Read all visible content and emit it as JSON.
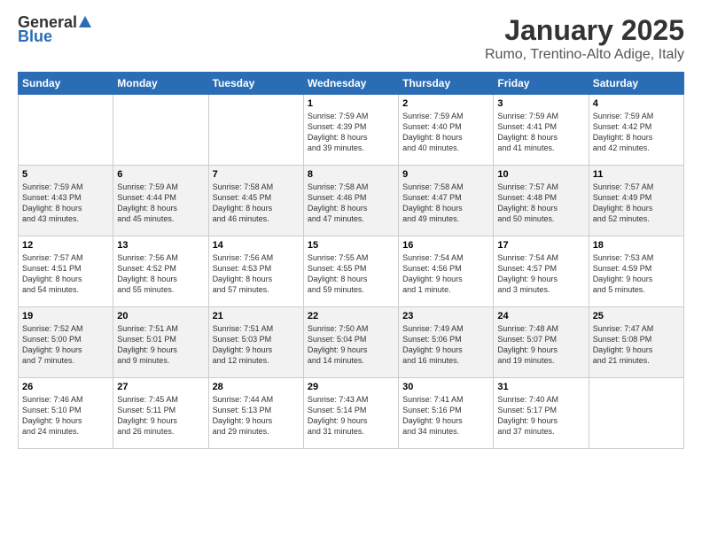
{
  "logo": {
    "general": "General",
    "blue": "Blue"
  },
  "header": {
    "title": "January 2025",
    "subtitle": "Rumo, Trentino-Alto Adige, Italy"
  },
  "columns": [
    "Sunday",
    "Monday",
    "Tuesday",
    "Wednesday",
    "Thursday",
    "Friday",
    "Saturday"
  ],
  "weeks": [
    [
      {
        "day": "",
        "info": ""
      },
      {
        "day": "",
        "info": ""
      },
      {
        "day": "",
        "info": ""
      },
      {
        "day": "1",
        "info": "Sunrise: 7:59 AM\nSunset: 4:39 PM\nDaylight: 8 hours\nand 39 minutes."
      },
      {
        "day": "2",
        "info": "Sunrise: 7:59 AM\nSunset: 4:40 PM\nDaylight: 8 hours\nand 40 minutes."
      },
      {
        "day": "3",
        "info": "Sunrise: 7:59 AM\nSunset: 4:41 PM\nDaylight: 8 hours\nand 41 minutes."
      },
      {
        "day": "4",
        "info": "Sunrise: 7:59 AM\nSunset: 4:42 PM\nDaylight: 8 hours\nand 42 minutes."
      }
    ],
    [
      {
        "day": "5",
        "info": "Sunrise: 7:59 AM\nSunset: 4:43 PM\nDaylight: 8 hours\nand 43 minutes."
      },
      {
        "day": "6",
        "info": "Sunrise: 7:59 AM\nSunset: 4:44 PM\nDaylight: 8 hours\nand 45 minutes."
      },
      {
        "day": "7",
        "info": "Sunrise: 7:58 AM\nSunset: 4:45 PM\nDaylight: 8 hours\nand 46 minutes."
      },
      {
        "day": "8",
        "info": "Sunrise: 7:58 AM\nSunset: 4:46 PM\nDaylight: 8 hours\nand 47 minutes."
      },
      {
        "day": "9",
        "info": "Sunrise: 7:58 AM\nSunset: 4:47 PM\nDaylight: 8 hours\nand 49 minutes."
      },
      {
        "day": "10",
        "info": "Sunrise: 7:57 AM\nSunset: 4:48 PM\nDaylight: 8 hours\nand 50 minutes."
      },
      {
        "day": "11",
        "info": "Sunrise: 7:57 AM\nSunset: 4:49 PM\nDaylight: 8 hours\nand 52 minutes."
      }
    ],
    [
      {
        "day": "12",
        "info": "Sunrise: 7:57 AM\nSunset: 4:51 PM\nDaylight: 8 hours\nand 54 minutes."
      },
      {
        "day": "13",
        "info": "Sunrise: 7:56 AM\nSunset: 4:52 PM\nDaylight: 8 hours\nand 55 minutes."
      },
      {
        "day": "14",
        "info": "Sunrise: 7:56 AM\nSunset: 4:53 PM\nDaylight: 8 hours\nand 57 minutes."
      },
      {
        "day": "15",
        "info": "Sunrise: 7:55 AM\nSunset: 4:55 PM\nDaylight: 8 hours\nand 59 minutes."
      },
      {
        "day": "16",
        "info": "Sunrise: 7:54 AM\nSunset: 4:56 PM\nDaylight: 9 hours\nand 1 minute."
      },
      {
        "day": "17",
        "info": "Sunrise: 7:54 AM\nSunset: 4:57 PM\nDaylight: 9 hours\nand 3 minutes."
      },
      {
        "day": "18",
        "info": "Sunrise: 7:53 AM\nSunset: 4:59 PM\nDaylight: 9 hours\nand 5 minutes."
      }
    ],
    [
      {
        "day": "19",
        "info": "Sunrise: 7:52 AM\nSunset: 5:00 PM\nDaylight: 9 hours\nand 7 minutes."
      },
      {
        "day": "20",
        "info": "Sunrise: 7:51 AM\nSunset: 5:01 PM\nDaylight: 9 hours\nand 9 minutes."
      },
      {
        "day": "21",
        "info": "Sunrise: 7:51 AM\nSunset: 5:03 PM\nDaylight: 9 hours\nand 12 minutes."
      },
      {
        "day": "22",
        "info": "Sunrise: 7:50 AM\nSunset: 5:04 PM\nDaylight: 9 hours\nand 14 minutes."
      },
      {
        "day": "23",
        "info": "Sunrise: 7:49 AM\nSunset: 5:06 PM\nDaylight: 9 hours\nand 16 minutes."
      },
      {
        "day": "24",
        "info": "Sunrise: 7:48 AM\nSunset: 5:07 PM\nDaylight: 9 hours\nand 19 minutes."
      },
      {
        "day": "25",
        "info": "Sunrise: 7:47 AM\nSunset: 5:08 PM\nDaylight: 9 hours\nand 21 minutes."
      }
    ],
    [
      {
        "day": "26",
        "info": "Sunrise: 7:46 AM\nSunset: 5:10 PM\nDaylight: 9 hours\nand 24 minutes."
      },
      {
        "day": "27",
        "info": "Sunrise: 7:45 AM\nSunset: 5:11 PM\nDaylight: 9 hours\nand 26 minutes."
      },
      {
        "day": "28",
        "info": "Sunrise: 7:44 AM\nSunset: 5:13 PM\nDaylight: 9 hours\nand 29 minutes."
      },
      {
        "day": "29",
        "info": "Sunrise: 7:43 AM\nSunset: 5:14 PM\nDaylight: 9 hours\nand 31 minutes."
      },
      {
        "day": "30",
        "info": "Sunrise: 7:41 AM\nSunset: 5:16 PM\nDaylight: 9 hours\nand 34 minutes."
      },
      {
        "day": "31",
        "info": "Sunrise: 7:40 AM\nSunset: 5:17 PM\nDaylight: 9 hours\nand 37 minutes."
      },
      {
        "day": "",
        "info": ""
      }
    ]
  ]
}
